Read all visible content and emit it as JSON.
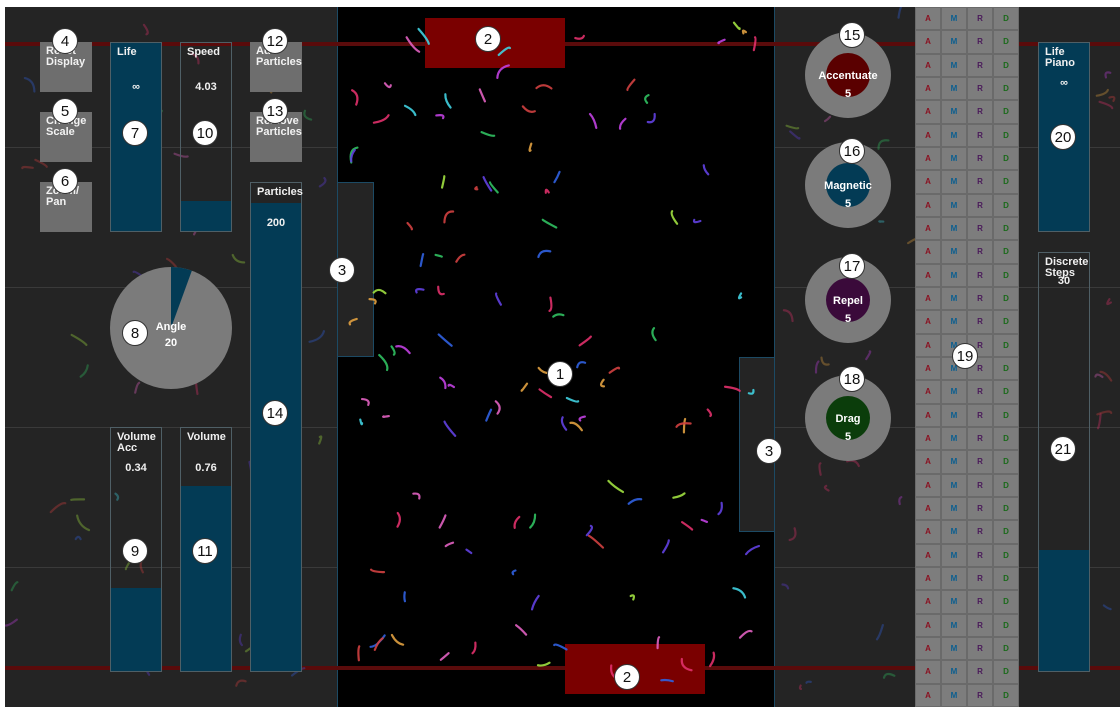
{
  "buttons": {
    "reset_display": "Reset\nDisplay",
    "change_scale": "Change\nScale",
    "zoom_pan": "Zoom/\nPan",
    "add_particles": "Add\nParticles",
    "remove_particles": "Remove\nParticles"
  },
  "sliders": {
    "life": {
      "label": "Life",
      "value": "∞",
      "level": 1.0
    },
    "speed": {
      "label": "Speed",
      "value": "4.03",
      "level": 0.16
    },
    "particles": {
      "label": "Particles",
      "value": "200",
      "level": 0.96
    },
    "volume_acc": {
      "label": "Volume\nAcc",
      "value": "0.34",
      "level": 0.34
    },
    "volume": {
      "label": "Volume",
      "value": "0.76",
      "level": 0.76
    },
    "life_piano": {
      "label": "Life\nPiano",
      "value": "∞",
      "level": 1.0
    },
    "discrete_steps": {
      "label": "Discrete\nSteps",
      "value": "30",
      "level": 0.29
    }
  },
  "angle_dial": {
    "label": "Angle",
    "value": "20",
    "wedge_degrees": 20
  },
  "force_rings": [
    {
      "label": "Accentuate",
      "value": "5",
      "color": "#5a0000"
    },
    {
      "label": "Magnetic",
      "value": "5",
      "color": "#033b55"
    },
    {
      "label": "Repel",
      "value": "5",
      "color": "#3a0a3a"
    },
    {
      "label": "Drag",
      "value": "5",
      "color": "#0b3d0b"
    }
  ],
  "grid_columns": [
    "A",
    "M",
    "R",
    "D"
  ],
  "grid_rows": 30,
  "callouts": {
    "n1": "1",
    "n2": "2",
    "n3": "3",
    "n4": "4",
    "n5": "5",
    "n6": "6",
    "n7": "7",
    "n8": "8",
    "n9": "9",
    "n10": "10",
    "n11": "11",
    "n12": "12",
    "n13": "13",
    "n14": "14",
    "n15": "15",
    "n16": "16",
    "n17": "17",
    "n18": "18",
    "n19": "19",
    "n20": "20",
    "n21": "21"
  },
  "colors": {
    "accent_blue": "#033b55",
    "panel_gray": "#6e6e6e",
    "paddle_red": "#7a0000",
    "background": "#242424",
    "arena": "#000000"
  }
}
